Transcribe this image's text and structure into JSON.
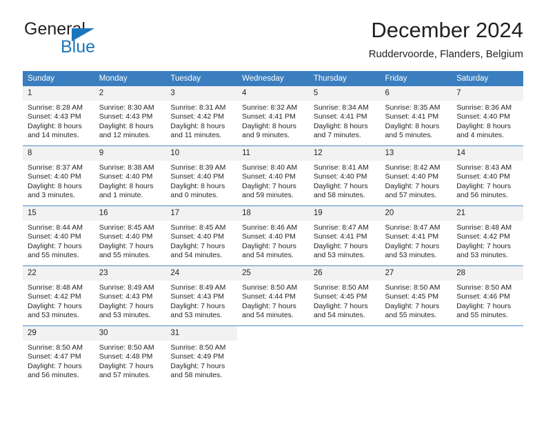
{
  "brand": {
    "name_top": "General",
    "name_bottom": "Blue",
    "accent_color": "#1a76bc"
  },
  "header": {
    "title": "December 2024",
    "subtitle": "Ruddervoorde, Flanders, Belgium"
  },
  "calendar": {
    "header_bg": "#3a7ebf",
    "daynum_bg": "#f2f2f2",
    "grid_line": "#4a89c8",
    "weekdays": [
      "Sunday",
      "Monday",
      "Tuesday",
      "Wednesday",
      "Thursday",
      "Friday",
      "Saturday"
    ],
    "weeks": [
      [
        {
          "day": "1",
          "sunrise": "Sunrise: 8:28 AM",
          "sunset": "Sunset: 4:43 PM",
          "daylight_1": "Daylight: 8 hours",
          "daylight_2": "and 14 minutes."
        },
        {
          "day": "2",
          "sunrise": "Sunrise: 8:30 AM",
          "sunset": "Sunset: 4:43 PM",
          "daylight_1": "Daylight: 8 hours",
          "daylight_2": "and 12 minutes."
        },
        {
          "day": "3",
          "sunrise": "Sunrise: 8:31 AM",
          "sunset": "Sunset: 4:42 PM",
          "daylight_1": "Daylight: 8 hours",
          "daylight_2": "and 11 minutes."
        },
        {
          "day": "4",
          "sunrise": "Sunrise: 8:32 AM",
          "sunset": "Sunset: 4:41 PM",
          "daylight_1": "Daylight: 8 hours",
          "daylight_2": "and 9 minutes."
        },
        {
          "day": "5",
          "sunrise": "Sunrise: 8:34 AM",
          "sunset": "Sunset: 4:41 PM",
          "daylight_1": "Daylight: 8 hours",
          "daylight_2": "and 7 minutes."
        },
        {
          "day": "6",
          "sunrise": "Sunrise: 8:35 AM",
          "sunset": "Sunset: 4:41 PM",
          "daylight_1": "Daylight: 8 hours",
          "daylight_2": "and 5 minutes."
        },
        {
          "day": "7",
          "sunrise": "Sunrise: 8:36 AM",
          "sunset": "Sunset: 4:40 PM",
          "daylight_1": "Daylight: 8 hours",
          "daylight_2": "and 4 minutes."
        }
      ],
      [
        {
          "day": "8",
          "sunrise": "Sunrise: 8:37 AM",
          "sunset": "Sunset: 4:40 PM",
          "daylight_1": "Daylight: 8 hours",
          "daylight_2": "and 3 minutes."
        },
        {
          "day": "9",
          "sunrise": "Sunrise: 8:38 AM",
          "sunset": "Sunset: 4:40 PM",
          "daylight_1": "Daylight: 8 hours",
          "daylight_2": "and 1 minute."
        },
        {
          "day": "10",
          "sunrise": "Sunrise: 8:39 AM",
          "sunset": "Sunset: 4:40 PM",
          "daylight_1": "Daylight: 8 hours",
          "daylight_2": "and 0 minutes."
        },
        {
          "day": "11",
          "sunrise": "Sunrise: 8:40 AM",
          "sunset": "Sunset: 4:40 PM",
          "daylight_1": "Daylight: 7 hours",
          "daylight_2": "and 59 minutes."
        },
        {
          "day": "12",
          "sunrise": "Sunrise: 8:41 AM",
          "sunset": "Sunset: 4:40 PM",
          "daylight_1": "Daylight: 7 hours",
          "daylight_2": "and 58 minutes."
        },
        {
          "day": "13",
          "sunrise": "Sunrise: 8:42 AM",
          "sunset": "Sunset: 4:40 PM",
          "daylight_1": "Daylight: 7 hours",
          "daylight_2": "and 57 minutes."
        },
        {
          "day": "14",
          "sunrise": "Sunrise: 8:43 AM",
          "sunset": "Sunset: 4:40 PM",
          "daylight_1": "Daylight: 7 hours",
          "daylight_2": "and 56 minutes."
        }
      ],
      [
        {
          "day": "15",
          "sunrise": "Sunrise: 8:44 AM",
          "sunset": "Sunset: 4:40 PM",
          "daylight_1": "Daylight: 7 hours",
          "daylight_2": "and 55 minutes."
        },
        {
          "day": "16",
          "sunrise": "Sunrise: 8:45 AM",
          "sunset": "Sunset: 4:40 PM",
          "daylight_1": "Daylight: 7 hours",
          "daylight_2": "and 55 minutes."
        },
        {
          "day": "17",
          "sunrise": "Sunrise: 8:45 AM",
          "sunset": "Sunset: 4:40 PM",
          "daylight_1": "Daylight: 7 hours",
          "daylight_2": "and 54 minutes."
        },
        {
          "day": "18",
          "sunrise": "Sunrise: 8:46 AM",
          "sunset": "Sunset: 4:40 PM",
          "daylight_1": "Daylight: 7 hours",
          "daylight_2": "and 54 minutes."
        },
        {
          "day": "19",
          "sunrise": "Sunrise: 8:47 AM",
          "sunset": "Sunset: 4:41 PM",
          "daylight_1": "Daylight: 7 hours",
          "daylight_2": "and 53 minutes."
        },
        {
          "day": "20",
          "sunrise": "Sunrise: 8:47 AM",
          "sunset": "Sunset: 4:41 PM",
          "daylight_1": "Daylight: 7 hours",
          "daylight_2": "and 53 minutes."
        },
        {
          "day": "21",
          "sunrise": "Sunrise: 8:48 AM",
          "sunset": "Sunset: 4:42 PM",
          "daylight_1": "Daylight: 7 hours",
          "daylight_2": "and 53 minutes."
        }
      ],
      [
        {
          "day": "22",
          "sunrise": "Sunrise: 8:48 AM",
          "sunset": "Sunset: 4:42 PM",
          "daylight_1": "Daylight: 7 hours",
          "daylight_2": "and 53 minutes."
        },
        {
          "day": "23",
          "sunrise": "Sunrise: 8:49 AM",
          "sunset": "Sunset: 4:43 PM",
          "daylight_1": "Daylight: 7 hours",
          "daylight_2": "and 53 minutes."
        },
        {
          "day": "24",
          "sunrise": "Sunrise: 8:49 AM",
          "sunset": "Sunset: 4:43 PM",
          "daylight_1": "Daylight: 7 hours",
          "daylight_2": "and 53 minutes."
        },
        {
          "day": "25",
          "sunrise": "Sunrise: 8:50 AM",
          "sunset": "Sunset: 4:44 PM",
          "daylight_1": "Daylight: 7 hours",
          "daylight_2": "and 54 minutes."
        },
        {
          "day": "26",
          "sunrise": "Sunrise: 8:50 AM",
          "sunset": "Sunset: 4:45 PM",
          "daylight_1": "Daylight: 7 hours",
          "daylight_2": "and 54 minutes."
        },
        {
          "day": "27",
          "sunrise": "Sunrise: 8:50 AM",
          "sunset": "Sunset: 4:45 PM",
          "daylight_1": "Daylight: 7 hours",
          "daylight_2": "and 55 minutes."
        },
        {
          "day": "28",
          "sunrise": "Sunrise: 8:50 AM",
          "sunset": "Sunset: 4:46 PM",
          "daylight_1": "Daylight: 7 hours",
          "daylight_2": "and 55 minutes."
        }
      ],
      [
        {
          "day": "29",
          "sunrise": "Sunrise: 8:50 AM",
          "sunset": "Sunset: 4:47 PM",
          "daylight_1": "Daylight: 7 hours",
          "daylight_2": "and 56 minutes."
        },
        {
          "day": "30",
          "sunrise": "Sunrise: 8:50 AM",
          "sunset": "Sunset: 4:48 PM",
          "daylight_1": "Daylight: 7 hours",
          "daylight_2": "and 57 minutes."
        },
        {
          "day": "31",
          "sunrise": "Sunrise: 8:50 AM",
          "sunset": "Sunset: 4:49 PM",
          "daylight_1": "Daylight: 7 hours",
          "daylight_2": "and 58 minutes."
        },
        {
          "day": "",
          "sunrise": "",
          "sunset": "",
          "daylight_1": "",
          "daylight_2": ""
        },
        {
          "day": "",
          "sunrise": "",
          "sunset": "",
          "daylight_1": "",
          "daylight_2": ""
        },
        {
          "day": "",
          "sunrise": "",
          "sunset": "",
          "daylight_1": "",
          "daylight_2": ""
        },
        {
          "day": "",
          "sunrise": "",
          "sunset": "",
          "daylight_1": "",
          "daylight_2": ""
        }
      ]
    ]
  }
}
